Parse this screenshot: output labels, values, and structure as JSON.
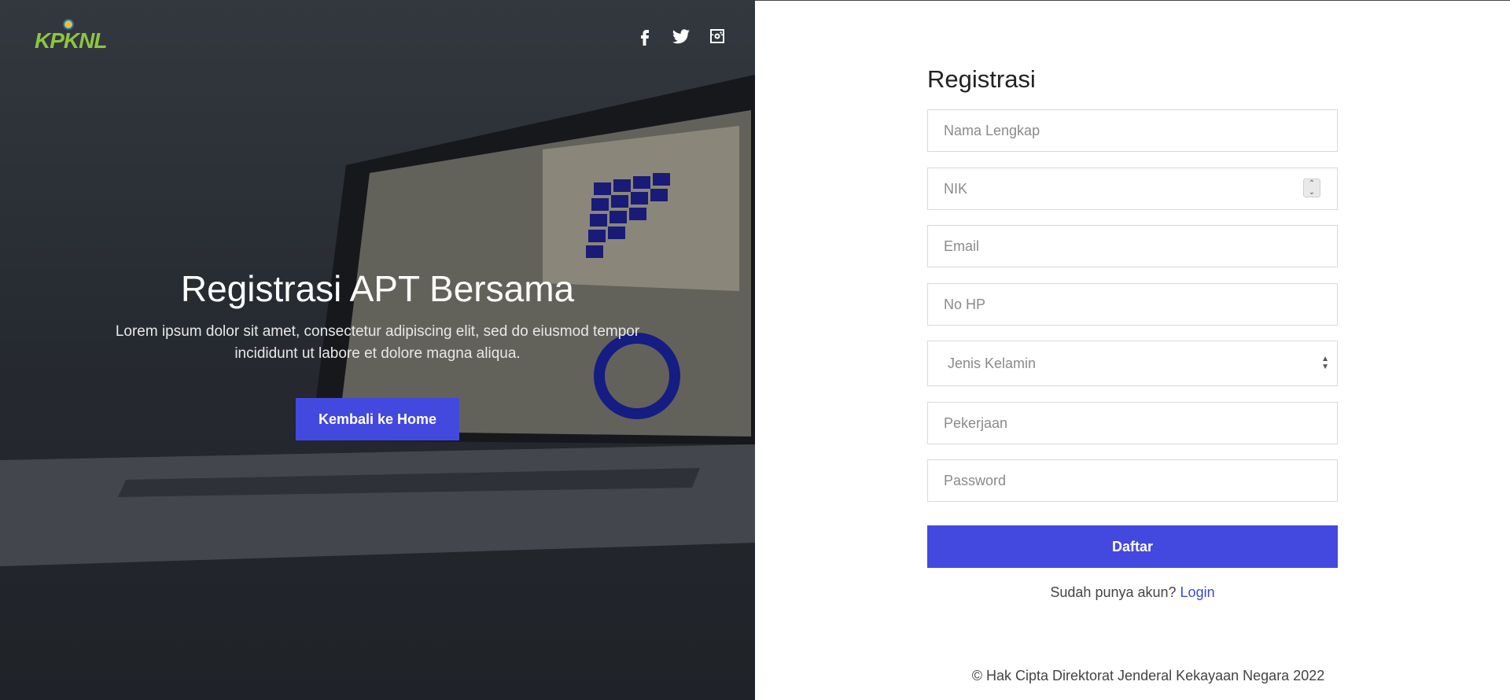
{
  "hero": {
    "logo_text": "KPKNL",
    "title": "Registrasi APT Bersama",
    "description": "Lorem ipsum dolor sit amet, consectetur adipiscing elit, sed do eiusmod tempor incididunt ut labore et dolore magna aliqua.",
    "home_button": "Kembali ke Home",
    "social": [
      "facebook-icon",
      "twitter-icon",
      "instagram-icon"
    ]
  },
  "form": {
    "title": "Registrasi",
    "fields": {
      "name_placeholder": "Nama Lengkap",
      "nik_placeholder": "NIK",
      "email_placeholder": "Email",
      "phone_placeholder": "No HP",
      "gender_placeholder": "Jenis Kelamin",
      "job_placeholder": "Pekerjaan",
      "password_placeholder": "Password"
    },
    "submit_label": "Daftar",
    "login_prompt": "Sudah punya akun?",
    "login_link": "Login"
  },
  "footer": {
    "copyright": "© Hak Cipta Direktorat Jenderal Kekayaan Negara 2022"
  },
  "colors": {
    "accent": "#4348df",
    "logo_green": "#8cc63f",
    "link": "#3a4bd6"
  }
}
